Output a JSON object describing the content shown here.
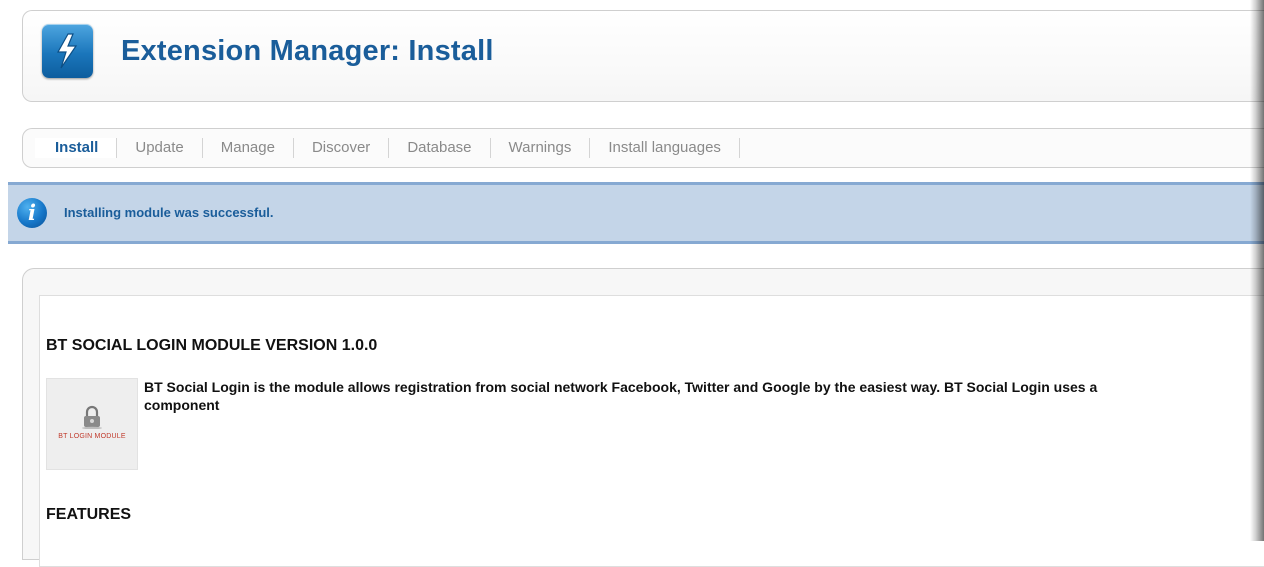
{
  "header": {
    "title": "Extension Manager: Install"
  },
  "tabs": [
    {
      "label": "Install",
      "active": true
    },
    {
      "label": "Update"
    },
    {
      "label": "Manage"
    },
    {
      "label": "Discover"
    },
    {
      "label": "Database"
    },
    {
      "label": "Warnings"
    },
    {
      "label": "Install languages"
    }
  ],
  "message": {
    "icon": "info-icon",
    "text": "Installing module was successful."
  },
  "content": {
    "module_title": "BT SOCIAL LOGIN MODULE VERSION 1.0.0",
    "thumbnail_label": "BT LOGIN MODULE",
    "description_line1": "BT Social Login is the module allows registration from social network Facebook, Twitter and Google by the easiest way. BT Social Login uses a",
    "description_line2": "component",
    "features_heading": "FEATURES"
  },
  "colors": {
    "accent": "#1a5d9a",
    "message_bg": "#c4d5e8",
    "message_border": "#86a9d2"
  }
}
